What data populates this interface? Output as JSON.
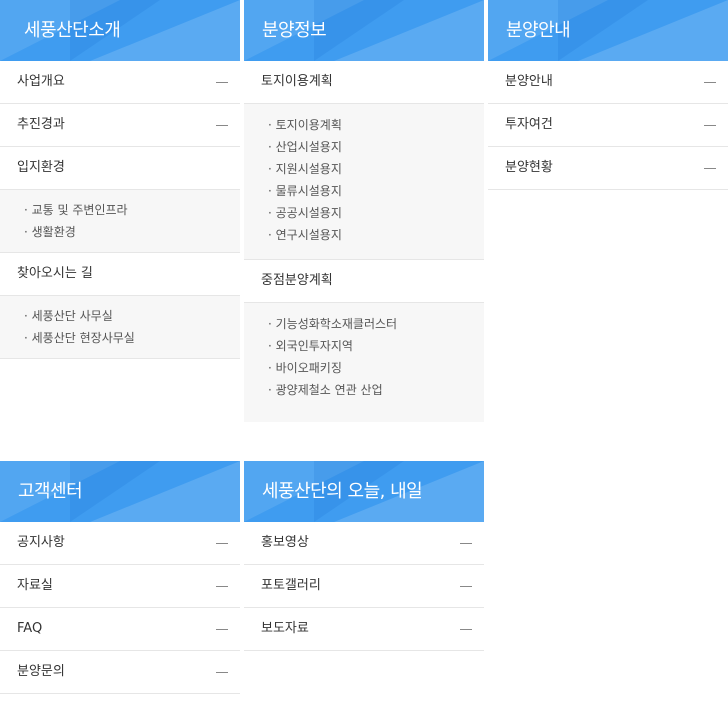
{
  "columns": {
    "intro": {
      "title": "세풍산단소개",
      "rows": [
        "사업개요",
        "추진경과",
        "입지환경",
        "찾아오시는 길"
      ],
      "sub_location": [
        "교통 및 주변인프라",
        "생활환경"
      ],
      "sub_directions": [
        "세풍산단 사무실",
        "세풍산단 현장사무실"
      ]
    },
    "sale_info": {
      "title": "분양정보",
      "group1": "토지이용계획",
      "group1_items": [
        "토지이용계획",
        "산업시설용지",
        "지원시설용지",
        "물류시설용지",
        "공공시설용지",
        "연구시설용지"
      ],
      "group2": "중점분양계획",
      "group2_items": [
        "기능성화학소재클러스터",
        "외국인투자지역",
        "바이오패키징",
        "광양제철소 연관 산업"
      ]
    },
    "sale_guide": {
      "title": "분양안내",
      "rows": [
        "분양안내",
        "투자여건",
        "분양현황"
      ]
    },
    "customer": {
      "title": "고객센터",
      "rows": [
        "공지사항",
        "자료실",
        "FAQ",
        "분양문의"
      ]
    },
    "today": {
      "title": "세풍산단의 오늘, 내일",
      "rows": [
        "홍보영상",
        "포토갤러리",
        "보도자료"
      ]
    }
  },
  "colors": {
    "header_blue": "#3f9cf0",
    "sub_bg": "#f7f7f7",
    "divider": "#e6e6e6"
  }
}
